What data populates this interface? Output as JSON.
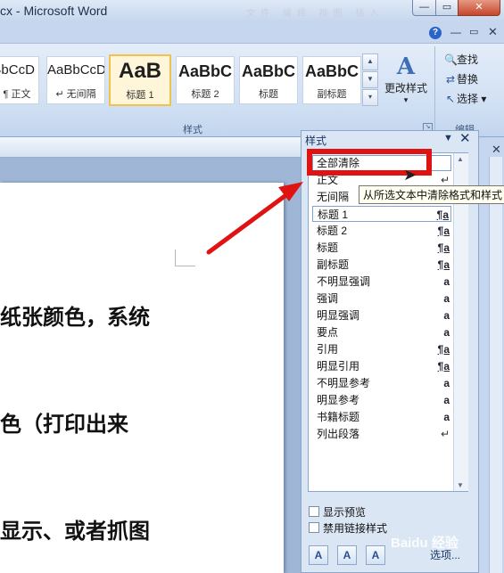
{
  "window": {
    "title": "cx - Microsoft Word",
    "title_ghost": "文件 编辑 视图 插入",
    "min_glyph": "—",
    "max_glyph": "▭",
    "close_glyph": "✕"
  },
  "ribbon": {
    "help_glyph": "?",
    "min_glyph": "—",
    "max_glyph": "▭",
    "close_glyph": "✕",
    "styles": [
      {
        "preview": "bBbCcD",
        "name": "¶ 正文"
      },
      {
        "preview": "AaBbCcD",
        "name": "↵ 无间隔"
      },
      {
        "preview": "AaB",
        "name": "标题 1"
      },
      {
        "preview": "AaBbC",
        "name": "标题 2"
      },
      {
        "preview": "AaBbC",
        "name": "标题"
      },
      {
        "preview": "AaBbC",
        "name": "副标题"
      }
    ],
    "scroll_up": "▲",
    "scroll_down": "▼",
    "scroll_more": "▾",
    "change_styles_icon": "A",
    "change_styles_label": "更改样式",
    "change_styles_caret": "▾",
    "group_styles_label": "样式",
    "launcher_glyph": "↘",
    "edit": {
      "find": "查找",
      "replace": "替换",
      "select": "选择",
      "group_label": "编辑"
    }
  },
  "document": {
    "lines": [
      "纸张颜色，系统",
      "色（打印出来",
      "显示、或者抓图"
    ]
  },
  "styles_pane": {
    "title": "样式",
    "dropdown_glyph": "▼",
    "close_glyph": "✕",
    "items": [
      {
        "name": "全部清除",
        "mark": ""
      },
      {
        "name": "正文",
        "mark": "↵"
      },
      {
        "name": "无间隔",
        "mark": "↵"
      },
      {
        "name": "标题 1",
        "mark": "¶a"
      },
      {
        "name": "标题 2",
        "mark": "¶a"
      },
      {
        "name": "标题",
        "mark": "¶a"
      },
      {
        "name": "副标题",
        "mark": "¶a"
      },
      {
        "name": "不明显强调",
        "mark": "a"
      },
      {
        "name": "强调",
        "mark": "a"
      },
      {
        "name": "明显强调",
        "mark": "a"
      },
      {
        "name": "要点",
        "mark": "a"
      },
      {
        "name": "引用",
        "mark": "¶a"
      },
      {
        "name": "明显引用",
        "mark": "¶a"
      },
      {
        "name": "不明显参考",
        "mark": "a"
      },
      {
        "name": "明显参考",
        "mark": "a"
      },
      {
        "name": "书籍标题",
        "mark": "a"
      },
      {
        "name": "列出段落",
        "mark": "↵"
      }
    ],
    "tooltip": "从所选文本中清除格式和样式",
    "show_preview": "显示预览",
    "disable_linked": "禁用链接样式",
    "options": "选项...",
    "scroll_up": "▲",
    "scroll_down": "▼"
  },
  "watermark": "Baidu 经验"
}
